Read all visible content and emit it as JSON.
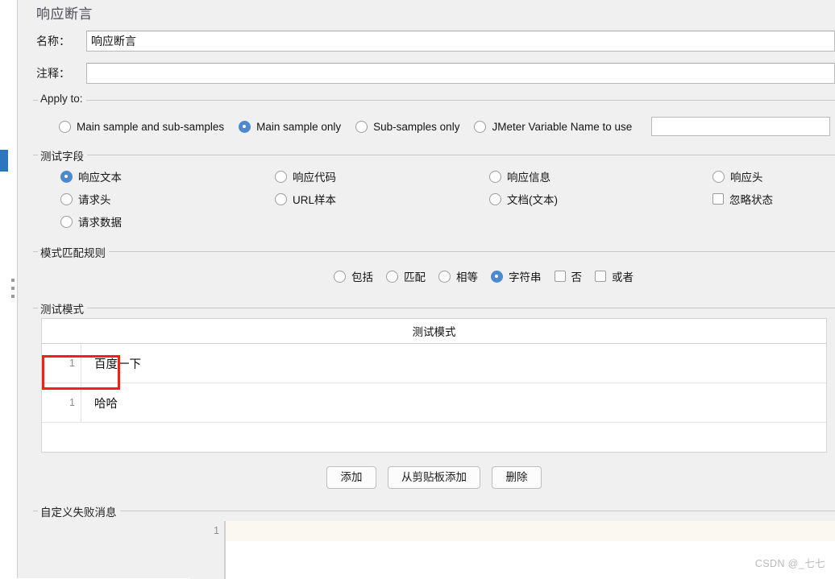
{
  "window": {
    "title": "响应断言",
    "watermark": "CSDN @_七七"
  },
  "form": {
    "name_label": "名称：",
    "name_value": "响应断言",
    "comment_label": "注释：",
    "comment_value": ""
  },
  "apply_to": {
    "legend": "Apply to:",
    "options": [
      {
        "label": "Main sample and sub-samples",
        "selected": false
      },
      {
        "label": "Main sample only",
        "selected": true
      },
      {
        "label": "Sub-samples only",
        "selected": false
      },
      {
        "label": "JMeter Variable Name to use",
        "selected": false
      }
    ],
    "variable_value": ""
  },
  "test_field": {
    "legend": "测试字段",
    "options": [
      {
        "label": "响应文本",
        "type": "radio",
        "selected": true
      },
      {
        "label": "响应代码",
        "type": "radio",
        "selected": false
      },
      {
        "label": "响应信息",
        "type": "radio",
        "selected": false
      },
      {
        "label": "响应头",
        "type": "radio",
        "selected": false
      },
      {
        "label": "请求头",
        "type": "radio",
        "selected": false
      },
      {
        "label": "URL样本",
        "type": "radio",
        "selected": false
      },
      {
        "label": "文档(文本)",
        "type": "radio",
        "selected": false
      },
      {
        "label": "忽略状态",
        "type": "checkbox",
        "selected": false
      },
      {
        "label": "请求数据",
        "type": "radio",
        "selected": false
      }
    ]
  },
  "pattern_rules": {
    "legend": "模式匹配规则",
    "options": [
      {
        "label": "包括",
        "type": "radio",
        "selected": false
      },
      {
        "label": "匹配",
        "type": "radio",
        "selected": false
      },
      {
        "label": "相等",
        "type": "radio",
        "selected": false
      },
      {
        "label": "字符串",
        "type": "radio",
        "selected": true
      },
      {
        "label": "否",
        "type": "checkbox",
        "selected": false
      },
      {
        "label": "或者",
        "type": "checkbox",
        "selected": false
      }
    ]
  },
  "patterns": {
    "legend": "测试模式",
    "column_header": "测试模式",
    "rows": [
      {
        "num": "1",
        "value": "百度一下"
      },
      {
        "num": "1",
        "value": "哈哈"
      }
    ],
    "buttons": [
      {
        "label": "添加"
      },
      {
        "label": "从剪贴板添加"
      },
      {
        "label": "删除"
      }
    ],
    "highlight_color": "#f41f15"
  },
  "fail_message": {
    "legend": "自定义失败消息",
    "line_number": "1",
    "value": ""
  },
  "colors": {
    "accent": "#4e89cd",
    "tab_marker": "#2c76bd",
    "panel_bg": "#f0f0f0",
    "active_line": "#fbf9ef"
  }
}
